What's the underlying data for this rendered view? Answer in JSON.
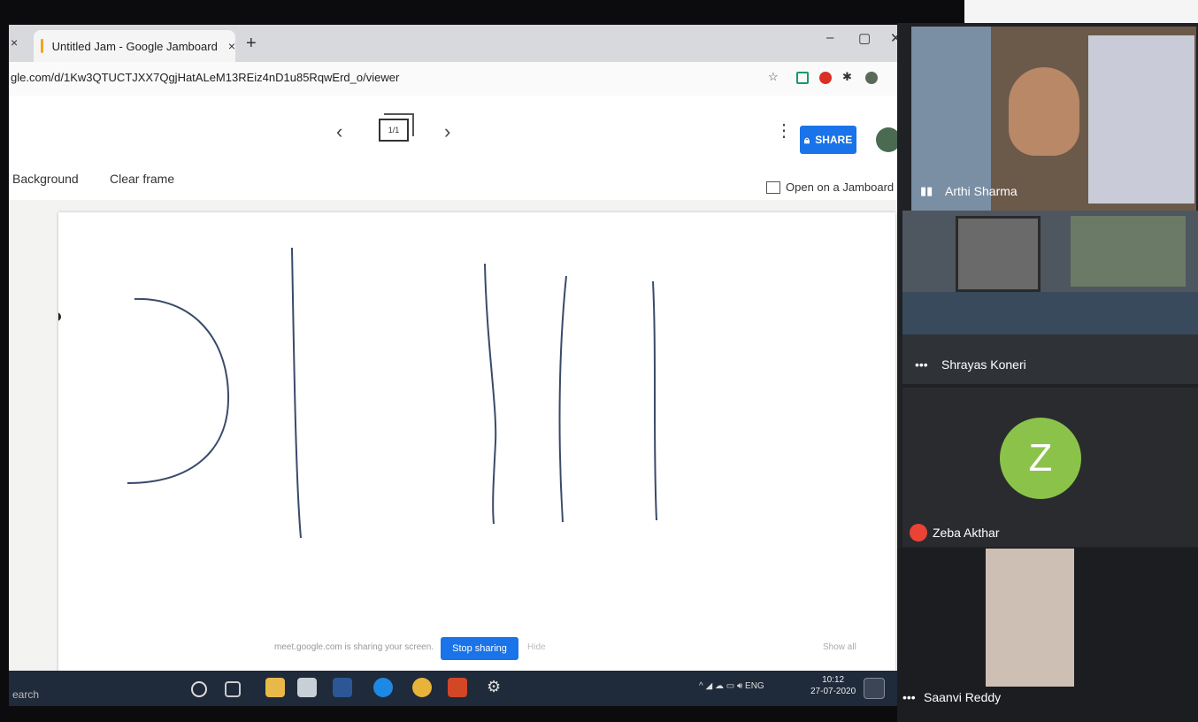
{
  "browser": {
    "tab_title": "Untitled Jam - Google Jamboard",
    "tab_close": "×",
    "new_tab": "+",
    "url": "gle.com/d/1Kw3QTUCTJXX7QgjHatALeM13REiz4nD1u85RqwErd_o/viewer",
    "window_minimize": "–",
    "window_restore": "▢",
    "window_close": "✕"
  },
  "jamboard": {
    "prev_frame": "‹",
    "next_frame": "›",
    "frame_indicator": "1/1",
    "share_label": "SHARE",
    "background_label": "Background",
    "clear_frame_label": "Clear frame",
    "open_on_jamboard_label": "Open on a Jamboard"
  },
  "screen_share": {
    "message": "meet.google.com is sharing your screen.",
    "stop_label": "Stop sharing",
    "hide_label": "Hide",
    "show_all_label": "Show all"
  },
  "taskbar": {
    "search_text": "earch",
    "tray_lang": "ENG",
    "time": "10:12",
    "date": "27-07-2020"
  },
  "meet": {
    "participants": [
      {
        "name": "Arthi Sharma"
      },
      {
        "name": "Shrayas Koneri"
      },
      {
        "name": "Zeba Akthar",
        "initial": "Z",
        "muted": true,
        "avatar_color": "#8bc34a"
      },
      {
        "name": "Saanvi Reddy"
      }
    ]
  },
  "colors": {
    "share_blue": "#1a73e8",
    "ink": "#3a4a6a"
  }
}
